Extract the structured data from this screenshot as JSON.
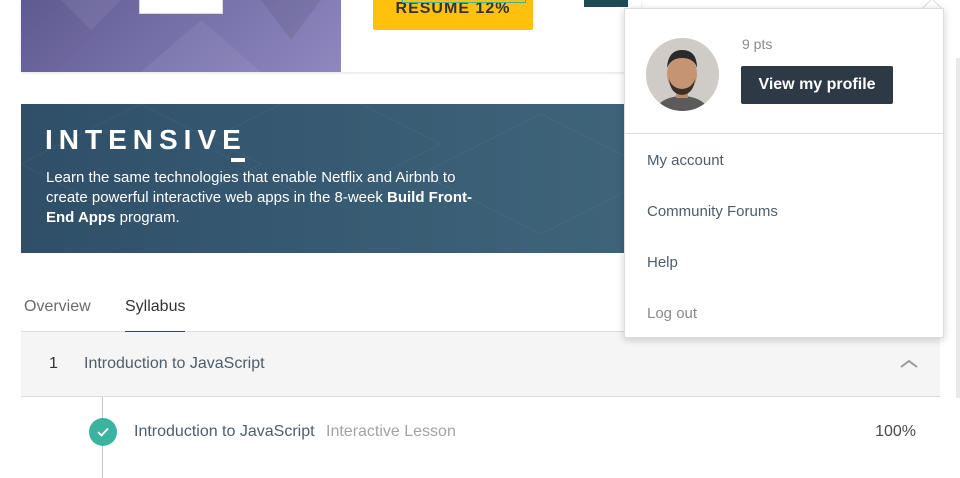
{
  "course_card": {
    "resume_label": "RESUME 12%"
  },
  "banner": {
    "title": "INTENSIVE",
    "text_before": "Learn the same technologies that enable Netflix and Airbnb to create powerful interactive web apps in the 8-week ",
    "text_bold": "Build Front-End Apps",
    "text_after": " program."
  },
  "tabs": [
    {
      "label": "Overview"
    },
    {
      "label": "Syllabus",
      "active": true
    }
  ],
  "syllabus": {
    "section_number": "1",
    "section_title": "Introduction to JavaScript",
    "lessons": [
      {
        "title": "Introduction to JavaScript",
        "type": "Interactive Lesson",
        "progress": "100%"
      }
    ]
  },
  "dropdown": {
    "points": "9 pts",
    "profile_button": "View my profile",
    "items": [
      "My account",
      "Community Forums",
      "Help",
      "Log out"
    ]
  },
  "colors": {
    "accent_green": "#3cb39f",
    "resume_yellow": "#ffc10e",
    "banner_blue": "#2f4f68",
    "profile_button": "#2d3a46"
  }
}
